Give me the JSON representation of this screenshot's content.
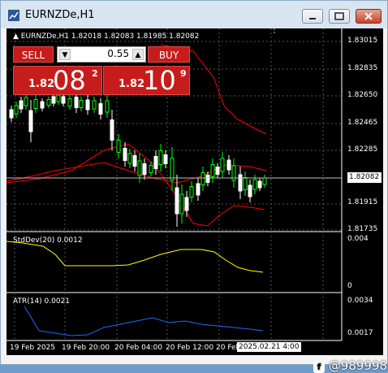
{
  "window": {
    "title": "EURNZDe,H1"
  },
  "chart": {
    "symbol_line": "EURNZDe,H1  1.82018 1.82083 1.81985 1.82082",
    "price_labels": [
      "1.83015",
      "1.82835",
      "1.82650",
      "1.82465",
      "1.82285",
      "1.81915",
      "1.81735"
    ],
    "current_price": "1.82082",
    "time_labels": [
      "19 Feb 2025",
      "19 Feb 20:00",
      "20 Feb 04:00",
      "20 Feb 12:00",
      "20 Feb"
    ],
    "crosshair_time": "2025.02.21 4:00"
  },
  "trade_panel": {
    "sell_label": "SELL",
    "buy_label": "BUY",
    "lot": "0.55",
    "sell_price_prefix": "1.82",
    "sell_price_big": "08",
    "sell_price_sup": "2",
    "buy_price_prefix": "1.82",
    "buy_price_big": "10",
    "buy_price_sup": "9"
  },
  "stddev": {
    "label": "StdDev(20) 0.0012",
    "scale_top": "0.004",
    "scale_bottom": "0"
  },
  "atr": {
    "label": "ATR(14) 0.0021",
    "scale_top": "0.0034",
    "scale_bottom": "0.0017"
  },
  "watermark": "@989998",
  "colors": {
    "bull": "#00ff00",
    "bear": "#ffffff",
    "bands": "#ff0000",
    "stddev": "#ffff00",
    "atr": "#1e69ff"
  }
}
